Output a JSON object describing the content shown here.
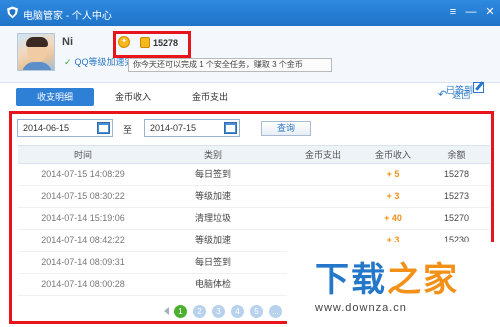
{
  "window": {
    "title": "电脑管家 - 个人中心",
    "menu_glyph": "≡",
    "minimize_glyph": "—",
    "close_glyph": "✕"
  },
  "profile": {
    "username": "Ni",
    "level_text": "QQ等级加速完成",
    "level_check": "✓",
    "medal_glyph": "✦",
    "coin_count": "15278",
    "tooltip": "你今天还可以完成 1 个安全任务，赚取 3 个金币",
    "signed_label": "已签到"
  },
  "tabs": [
    {
      "label": "收支明细",
      "active": true
    },
    {
      "label": "金币收入",
      "active": false
    },
    {
      "label": "金币支出",
      "active": false
    }
  ],
  "back": {
    "arrow": "↶",
    "label": "返回"
  },
  "filter": {
    "start_date": "2014-06-15",
    "to_label": "至",
    "end_date": "2014-07-15",
    "query_label": "查询"
  },
  "table": {
    "headers": {
      "time": "时间",
      "type": "类别",
      "out": "金币支出",
      "in": "金币收入",
      "balance": "余额"
    },
    "rows": [
      {
        "time": "2014-07-15 14:08:29",
        "type": "每日签到",
        "out": "",
        "in": "+ 5",
        "balance": "15278"
      },
      {
        "time": "2014-07-15 08:30:22",
        "type": "等级加速",
        "out": "",
        "in": "+ 3",
        "balance": "15273"
      },
      {
        "time": "2014-07-14 15:19:06",
        "type": "清理垃圾",
        "out": "",
        "in": "+ 40",
        "balance": "15270"
      },
      {
        "time": "2014-07-14 08:42:22",
        "type": "等级加速",
        "out": "",
        "in": "+ 3",
        "balance": "15230"
      },
      {
        "time": "2014-07-14 08:09:31",
        "type": "每日签到",
        "out": "",
        "in": "",
        "balance": ""
      },
      {
        "time": "2014-07-14 08:00:28",
        "type": "电脑体检",
        "out": "",
        "in": "",
        "balance": ""
      }
    ]
  },
  "pager": {
    "pages": [
      "1",
      "2",
      "3",
      "4",
      "5",
      "..."
    ],
    "current": "1"
  },
  "watermark": {
    "title_part1": "下载",
    "title_part2": "之家",
    "url": "www.downza.cn"
  },
  "colors": {
    "titlebar": "#1f74c8",
    "highlight_border": "#e8141b",
    "accent_blue": "#2e7fd6",
    "income_orange": "#f39018",
    "pager_current": "#4caf2f"
  }
}
